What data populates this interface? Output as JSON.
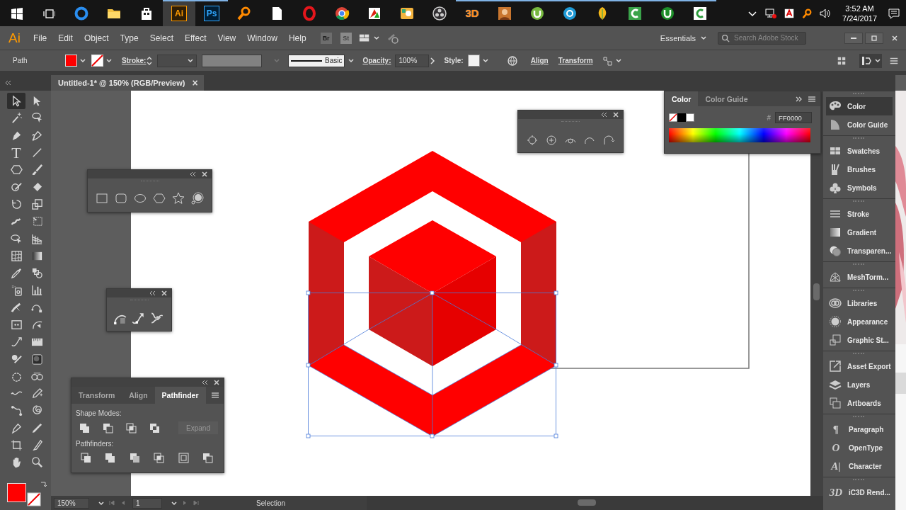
{
  "taskbar": {
    "apps": [
      {
        "selected": false,
        "running": false
      },
      {
        "selected": false,
        "running": false
      },
      {
        "selected": false,
        "running": false
      },
      {
        "label": "Ai",
        "selected": true,
        "running": true
      },
      {
        "label": "Ps",
        "selected": false,
        "running": true
      },
      {
        "selected": false,
        "running": false
      },
      {
        "selected": false,
        "running": false
      },
      {
        "selected": false,
        "running": false
      },
      {
        "selected": false,
        "running": false
      },
      {
        "selected": false,
        "running": false
      },
      {
        "selected": false,
        "running": false
      },
      {
        "selected": false,
        "running": false
      },
      {
        "label": "3D",
        "selected": false,
        "running": true
      },
      {
        "selected": false,
        "running": true
      },
      {
        "selected": false,
        "running": true
      },
      {
        "selected": false,
        "running": true
      },
      {
        "selected": false,
        "running": true
      },
      {
        "selected": false,
        "running": true
      },
      {
        "selected": false,
        "running": true
      },
      {
        "selected": false,
        "running": true
      }
    ],
    "clock": {
      "time": "3:52 AM",
      "date": "7/24/2017"
    }
  },
  "menubar": {
    "logo": "Ai",
    "menus": [
      "File",
      "Edit",
      "Object",
      "Type",
      "Select",
      "Effect",
      "View",
      "Window",
      "Help"
    ],
    "bridge": "Br",
    "stock": "St",
    "workspace": "Essentials",
    "search_placeholder": "Search Adobe Stock"
  },
  "control_bar": {
    "selection": "Path",
    "stroke_label": "Stroke:",
    "brush": "Basic",
    "opacity_label": "Opacity:",
    "opacity": "100%",
    "style_label": "Style:",
    "align": "Align",
    "transform": "Transform"
  },
  "document_tab": {
    "title": "Untitled-1* @ 150% (RGB/Preview)",
    "close": "×"
  },
  "toolbox": {
    "tools": [
      {
        "selected": true
      },
      {
        "selected": false
      },
      {
        "selected": false
      },
      {
        "selected": false
      },
      {
        "selected": false
      },
      {
        "selected": false
      },
      {
        "label": "T",
        "selected": false
      },
      {
        "selected": false
      },
      {
        "selected": false
      },
      {
        "selected": false
      },
      {
        "selected": false
      },
      {
        "selected": false
      },
      {
        "selected": false
      },
      {
        "selected": false
      },
      {
        "selected": false
      },
      {
        "selected": false
      },
      {
        "selected": false
      },
      {
        "selected": false
      },
      {
        "selected": false
      },
      {
        "selected": false
      },
      {
        "selected": false
      },
      {
        "selected": false
      },
      {
        "selected": false
      },
      {
        "selected": false
      },
      {
        "selected": false
      },
      {
        "selected": false
      },
      {
        "selected": false
      },
      {
        "selected": false
      },
      {
        "selected": false
      },
      {
        "selected": false
      },
      {
        "selected": false
      },
      {
        "selected": false
      },
      {
        "selected": false
      },
      {
        "selected": false
      },
      {
        "selected": false
      },
      {
        "selected": false
      },
      {
        "selected": false
      },
      {
        "selected": false
      },
      {
        "selected": false
      },
      {
        "selected": false
      },
      {
        "selected": false
      },
      {
        "selected": false
      },
      {
        "selected": false
      },
      {
        "selected": false
      }
    ]
  },
  "pathfinder_panel": {
    "tabs": [
      {
        "label": "Transform",
        "selected": false
      },
      {
        "label": "Align",
        "selected": false
      },
      {
        "label": "Pathfinder",
        "selected": true
      }
    ],
    "shape_modes_label": "Shape Modes:",
    "expand": {
      "label": "Expand",
      "disabled": true
    },
    "pathfinders_label": "Pathfinders:"
  },
  "color_panel": {
    "tabs": [
      {
        "label": "Color",
        "selected": true
      },
      {
        "label": "Color Guide",
        "selected": false
      }
    ],
    "hex_label": "#",
    "hex": "FF0000"
  },
  "dock": {
    "groups": [
      [
        {
          "label": "Color",
          "selected": true
        },
        {
          "label": "Color Guide",
          "selected": false
        }
      ],
      [
        {
          "label": "Swatches",
          "selected": false
        },
        {
          "label": "Brushes",
          "selected": false
        },
        {
          "label": "Symbols",
          "selected": false
        }
      ],
      [
        {
          "label": "Stroke",
          "selected": false
        },
        {
          "label": "Gradient",
          "selected": false
        },
        {
          "label": "Transparen...",
          "selected": false
        }
      ],
      [
        {
          "label": "MeshTorm...",
          "selected": false
        }
      ],
      [
        {
          "label": "Libraries",
          "selected": false
        },
        {
          "label": "Appearance",
          "selected": false
        },
        {
          "label": "Graphic St...",
          "selected": false
        }
      ],
      [
        {
          "label": "Asset Export",
          "selected": false
        },
        {
          "label": "Layers",
          "selected": false
        },
        {
          "label": "Artboards",
          "selected": false
        }
      ],
      [
        {
          "label": "Paragraph",
          "icon_text": "¶",
          "selected": false
        },
        {
          "label": "OpenType",
          "icon_text": "O",
          "selected": false
        },
        {
          "label": "Character",
          "icon_text": "A|",
          "selected": false
        }
      ],
      [
        {
          "label": "iC3D Rend...",
          "icon_text": "3D",
          "selected": false
        }
      ]
    ]
  },
  "status_bar": {
    "zoom": "150%",
    "artboard": "1",
    "tool": "Selection"
  }
}
